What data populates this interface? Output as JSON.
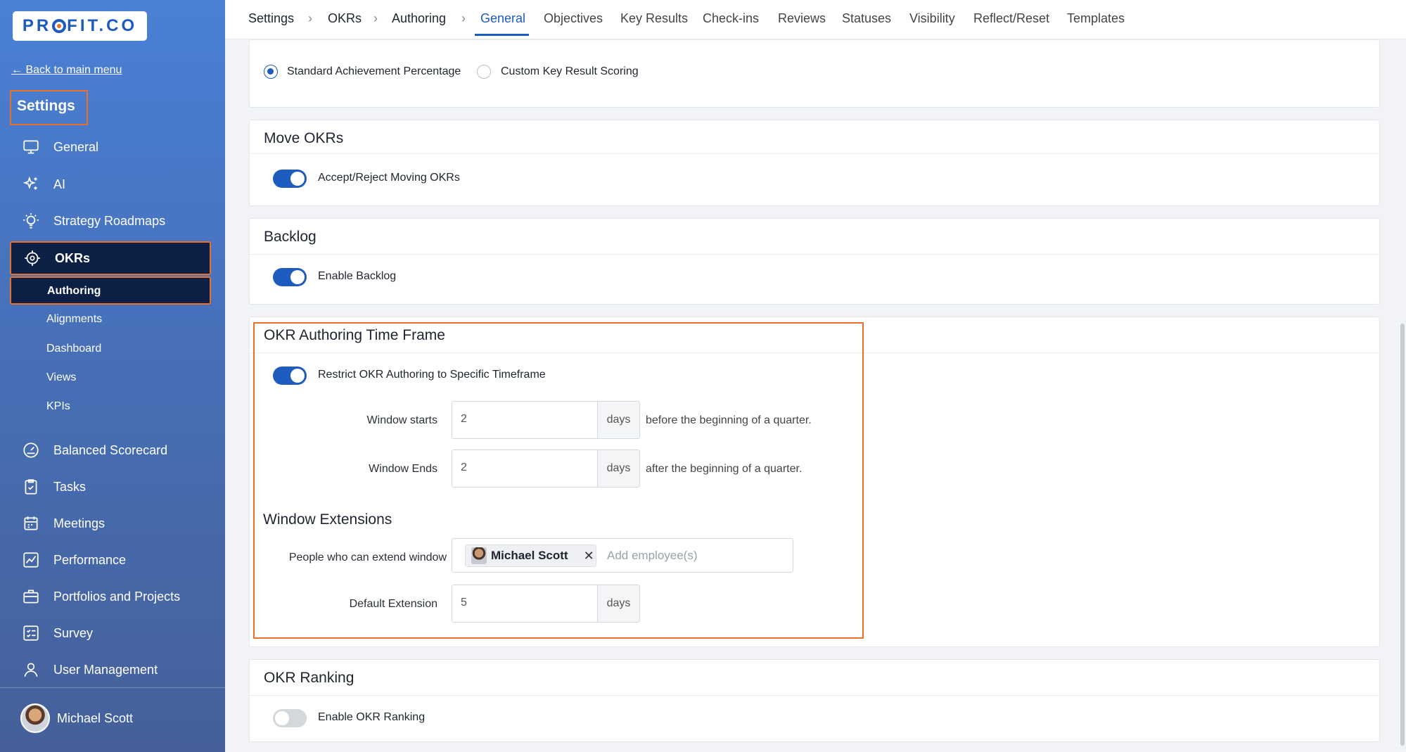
{
  "brand": {
    "logo_pre": "PR",
    "logo_post": "FIT.CO"
  },
  "sidebar": {
    "back_link": "← Back to main menu",
    "title": "Settings",
    "items": [
      {
        "label": "General",
        "icon": "monitor-icon"
      },
      {
        "label": "AI",
        "icon": "sparkle-icon"
      },
      {
        "label": "Strategy Roadmaps",
        "icon": "lightbulb-icon"
      },
      {
        "label": "OKRs",
        "icon": "target-icon"
      },
      {
        "label": "Balanced Scorecard",
        "icon": "gauge-icon"
      },
      {
        "label": "Tasks",
        "icon": "clipboard-check-icon"
      },
      {
        "label": "Meetings",
        "icon": "calendar-icon"
      },
      {
        "label": "Performance",
        "icon": "trend-icon"
      },
      {
        "label": "Portfolios and Projects",
        "icon": "briefcase-icon"
      },
      {
        "label": "Survey",
        "icon": "checklist-icon"
      },
      {
        "label": "User Management",
        "icon": "user-icon"
      }
    ],
    "okr_subitems": [
      "Authoring",
      "Alignments",
      "Dashboard",
      "Views",
      "KPIs"
    ],
    "user_name": "Michael Scott"
  },
  "topnav": {
    "breadcrumbs": [
      "Settings",
      "OKRs",
      "Authoring"
    ],
    "separator": "›",
    "tabs": [
      "General",
      "Objectives",
      "Key Results",
      "Check-ins",
      "Reviews",
      "Statuses",
      "Visibility",
      "Reflect/Reset",
      "Templates"
    ],
    "active_tab": "General"
  },
  "scoring": {
    "option1": "Standard Achievement Percentage",
    "option2": "Custom Key Result Scoring",
    "selected": "Standard Achievement Percentage"
  },
  "move_okrs": {
    "title": "Move OKRs",
    "toggle_label": "Accept/Reject Moving OKRs",
    "enabled": true
  },
  "backlog": {
    "title": "Backlog",
    "toggle_label": "Enable Backlog",
    "enabled": true
  },
  "time_frame": {
    "title": "OKR Authoring Time Frame",
    "toggle_label": "Restrict OKR Authoring to Specific Timeframe",
    "enabled": true,
    "window_starts_label": "Window starts",
    "window_starts_value": "2",
    "window_starts_help": "before the beginning of a quarter.",
    "window_ends_label": "Window Ends",
    "window_ends_value": "2",
    "window_ends_help": "after the beginning of a quarter.",
    "unit": "days",
    "extensions_title": "Window Extensions",
    "people_label": "People who can extend window",
    "person_chip": "Michael Scott",
    "remove_glyph": "✕",
    "people_placeholder": "Add employee(s)",
    "default_extension_label": "Default Extension",
    "default_extension_value": "5"
  },
  "ranking": {
    "title": "OKR Ranking",
    "toggle_label": "Enable OKR Ranking",
    "enabled": false
  },
  "colors": {
    "accent": "#1e5bbf",
    "highlight": "#e8702a",
    "sidebar_active": "#0c1f45"
  }
}
